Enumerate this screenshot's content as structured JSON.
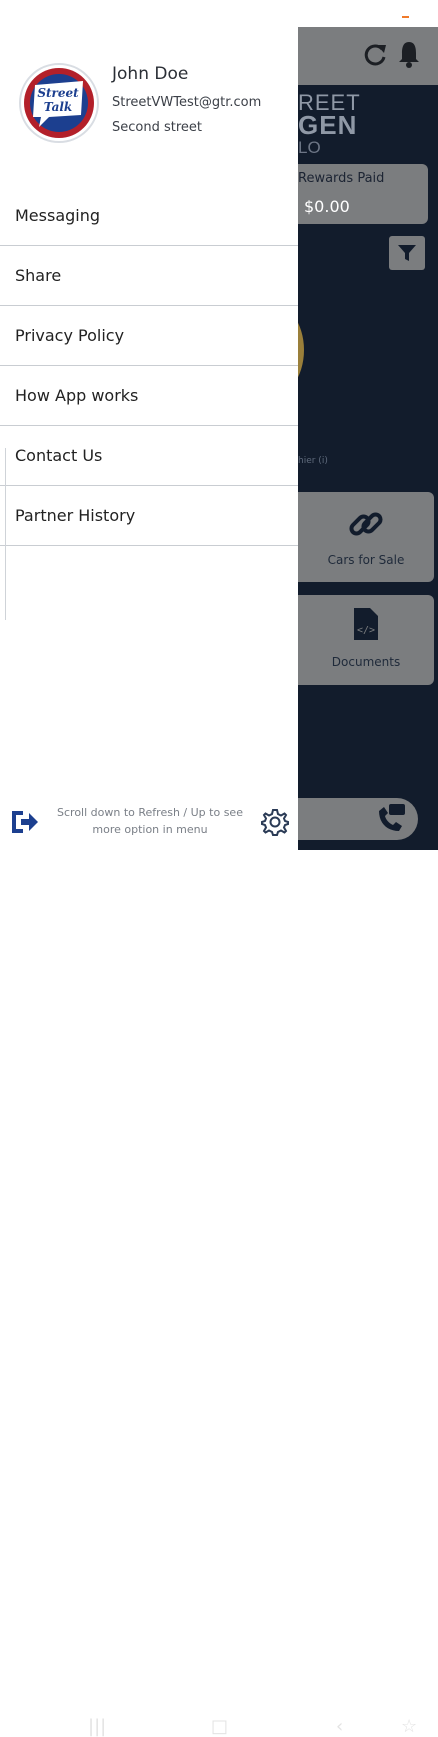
{
  "drawer": {
    "user": {
      "name": "John Doe",
      "email": "StreetVWTest@gtr.com",
      "address": "Second street"
    },
    "logo": {
      "text_line1": "Street",
      "text_line2": "Talk",
      "accent": "#1c3f8f",
      "brand": "#b3202a"
    },
    "menu_items": [
      {
        "label": "Messaging"
      },
      {
        "label": "Share"
      },
      {
        "label": "Privacy Policy"
      },
      {
        "label": "How App works"
      },
      {
        "label": "Contact Us"
      },
      {
        "label": "Partner History"
      }
    ],
    "footer_hint": "Scroll down to Refresh / Up to see more option in menu"
  },
  "background_app": {
    "title_line1": "REET",
    "title_line2": "GEN",
    "title_line3": "LO",
    "rewards_label": "Rewards Paid",
    "rewards_value": "$0.00",
    "tiny_label": "hier (i)",
    "tiles": [
      {
        "label": "Cars for Sale",
        "icon": "link-icon"
      },
      {
        "label": "Documents",
        "icon": "document-code-icon"
      }
    ]
  },
  "colors": {
    "dark_panel": "#121c2c",
    "gray_tile": "#7b7d7f",
    "divider": "#c9cdd2"
  }
}
